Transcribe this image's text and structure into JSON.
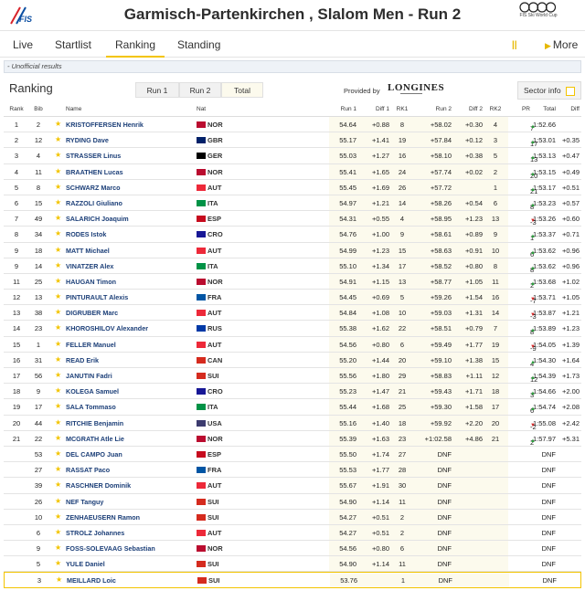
{
  "header": {
    "logo_text": "FIS",
    "title": "Garmisch-Partenkirchen , Slalom Men - Run 2",
    "sponsor_sub": "FIS Ski World Cup"
  },
  "nav": {
    "tabs": [
      "Live",
      "Startlist",
      "Ranking",
      "Standing"
    ],
    "active": "Ranking",
    "pause_icon": "||",
    "more_label": "More"
  },
  "notice": "- Unofficial results",
  "ranking": {
    "heading": "Ranking",
    "buttons": [
      "Run 1",
      "Run 2",
      "Total"
    ],
    "active_button": "Total",
    "provided_by": "Provided by",
    "sponsor": "LONGINES",
    "sector_info": "Sector info"
  },
  "columns": {
    "rank": "Rank",
    "bib": "Bib",
    "name": "Name",
    "nat": "Nat",
    "run1": "Run 1",
    "diff1": "Diff 1",
    "rk1": "RK1",
    "run2": "Run 2",
    "diff2": "Diff 2",
    "rk2": "RK2",
    "pr": "PR",
    "total": "Total",
    "diff": "Diff"
  },
  "flags": {
    "NOR": "#ba0c2f",
    "GBR": "#012169",
    "GER": "#000000",
    "AUT": "#ed2939",
    "ITA": "#009246",
    "ESP": "#c60b1e",
    "CRO": "#171796",
    "FRA": "#0055a4",
    "RUS": "#0039a6",
    "CAN": "#d52b1e",
    "SUI": "#d52b1e",
    "USA": "#3c3b6e"
  },
  "rows": [
    {
      "rank": "1",
      "bib": "2",
      "name": "KRISTOFFERSEN Henrik",
      "nat": "NOR",
      "run1": "54.64",
      "diff1": "+0.88",
      "rk1": "8",
      "run2": "+58.02",
      "diff2": "+0.30",
      "rk2": "4",
      "pr": "7",
      "trend": "up",
      "total": "1:52.66",
      "diff": ""
    },
    {
      "rank": "2",
      "bib": "12",
      "name": "RYDING Dave",
      "nat": "GBR",
      "run1": "55.17",
      "diff1": "+1.41",
      "rk1": "19",
      "run2": "+57.84",
      "diff2": "+0.12",
      "rk2": "3",
      "pr": "17",
      "trend": "up",
      "total": "1:53.01",
      "diff": "+0.35"
    },
    {
      "rank": "3",
      "bib": "4",
      "name": "STRASSER Linus",
      "nat": "GER",
      "run1": "55.03",
      "diff1": "+1.27",
      "rk1": "16",
      "run2": "+58.10",
      "diff2": "+0.38",
      "rk2": "5",
      "pr": "13",
      "trend": "up",
      "total": "1:53.13",
      "diff": "+0.47"
    },
    {
      "rank": "4",
      "bib": "11",
      "name": "BRAATHEN Lucas",
      "nat": "NOR",
      "run1": "55.41",
      "diff1": "+1.65",
      "rk1": "24",
      "run2": "+57.74",
      "diff2": "+0.02",
      "rk2": "2",
      "pr": "20",
      "trend": "up",
      "total": "1:53.15",
      "diff": "+0.49"
    },
    {
      "rank": "5",
      "bib": "8",
      "name": "SCHWARZ Marco",
      "nat": "AUT",
      "run1": "55.45",
      "diff1": "+1.69",
      "rk1": "26",
      "run2": "+57.72",
      "diff2": "",
      "rk2": "1",
      "pr": "21",
      "trend": "up",
      "total": "1:53.17",
      "diff": "+0.51"
    },
    {
      "rank": "6",
      "bib": "15",
      "name": "RAZZOLI Giuliano",
      "nat": "ITA",
      "run1": "54.97",
      "diff1": "+1.21",
      "rk1": "14",
      "run2": "+58.26",
      "diff2": "+0.54",
      "rk2": "6",
      "pr": "8",
      "trend": "up",
      "total": "1:53.23",
      "diff": "+0.57"
    },
    {
      "rank": "7",
      "bib": "49",
      "name": "SALARICH Joaquim",
      "nat": "ESP",
      "run1": "54.31",
      "diff1": "+0.55",
      "rk1": "4",
      "run2": "+58.95",
      "diff2": "+1.23",
      "rk2": "13",
      "pr": "-3",
      "trend": "down",
      "total": "1:53.26",
      "diff": "+0.60"
    },
    {
      "rank": "8",
      "bib": "34",
      "name": "RODES Istok",
      "nat": "CRO",
      "run1": "54.76",
      "diff1": "+1.00",
      "rk1": "9",
      "run2": "+58.61",
      "diff2": "+0.89",
      "rk2": "9",
      "pr": "1",
      "trend": "up",
      "total": "1:53.37",
      "diff": "+0.71"
    },
    {
      "rank": "9",
      "bib": "18",
      "name": "MATT Michael",
      "nat": "AUT",
      "run1": "54.99",
      "diff1": "+1.23",
      "rk1": "15",
      "run2": "+58.63",
      "diff2": "+0.91",
      "rk2": "10",
      "pr": "6",
      "trend": "up",
      "total": "1:53.62",
      "diff": "+0.96"
    },
    {
      "rank": "9",
      "bib": "14",
      "name": "VINATZER Alex",
      "nat": "ITA",
      "run1": "55.10",
      "diff1": "+1.34",
      "rk1": "17",
      "run2": "+58.52",
      "diff2": "+0.80",
      "rk2": "8",
      "pr": "8",
      "trend": "up",
      "total": "1:53.62",
      "diff": "+0.96"
    },
    {
      "rank": "11",
      "bib": "25",
      "name": "HAUGAN Timon",
      "nat": "NOR",
      "run1": "54.91",
      "diff1": "+1.15",
      "rk1": "13",
      "run2": "+58.77",
      "diff2": "+1.05",
      "rk2": "11",
      "pr": "2",
      "trend": "up",
      "total": "1:53.68",
      "diff": "+1.02"
    },
    {
      "rank": "12",
      "bib": "13",
      "name": "PINTURAULT Alexis",
      "nat": "FRA",
      "run1": "54.45",
      "diff1": "+0.69",
      "rk1": "5",
      "run2": "+59.26",
      "diff2": "+1.54",
      "rk2": "16",
      "pr": "-7",
      "trend": "down",
      "total": "1:53.71",
      "diff": "+1.05"
    },
    {
      "rank": "13",
      "bib": "38",
      "name": "DIGRUBER Marc",
      "nat": "AUT",
      "run1": "54.84",
      "diff1": "+1.08",
      "rk1": "10",
      "run2": "+59.03",
      "diff2": "+1.31",
      "rk2": "14",
      "pr": "-3",
      "trend": "down",
      "total": "1:53.87",
      "diff": "+1.21"
    },
    {
      "rank": "14",
      "bib": "23",
      "name": "KHOROSHILOV Alexander",
      "nat": "RUS",
      "run1": "55.38",
      "diff1": "+1.62",
      "rk1": "22",
      "run2": "+58.51",
      "diff2": "+0.79",
      "rk2": "7",
      "pr": "8",
      "trend": "up",
      "total": "1:53.89",
      "diff": "+1.23"
    },
    {
      "rank": "15",
      "bib": "1",
      "name": "FELLER Manuel",
      "nat": "AUT",
      "run1": "54.56",
      "diff1": "+0.80",
      "rk1": "6",
      "run2": "+59.49",
      "diff2": "+1.77",
      "rk2": "19",
      "pr": "-9",
      "trend": "down",
      "total": "1:54.05",
      "diff": "+1.39"
    },
    {
      "rank": "16",
      "bib": "31",
      "name": "READ Erik",
      "nat": "CAN",
      "run1": "55.20",
      "diff1": "+1.44",
      "rk1": "20",
      "run2": "+59.10",
      "diff2": "+1.38",
      "rk2": "15",
      "pr": "4",
      "trend": "up",
      "total": "1:54.30",
      "diff": "+1.64"
    },
    {
      "rank": "17",
      "bib": "56",
      "name": "JANUTIN Fadri",
      "nat": "SUI",
      "run1": "55.56",
      "diff1": "+1.80",
      "rk1": "29",
      "run2": "+58.83",
      "diff2": "+1.11",
      "rk2": "12",
      "pr": "12",
      "trend": "up",
      "total": "1:54.39",
      "diff": "+1.73"
    },
    {
      "rank": "18",
      "bib": "9",
      "name": "KOLEGA Samuel",
      "nat": "CRO",
      "run1": "55.23",
      "diff1": "+1.47",
      "rk1": "21",
      "run2": "+59.43",
      "diff2": "+1.71",
      "rk2": "18",
      "pr": "3",
      "trend": "up",
      "total": "1:54.66",
      "diff": "+2.00"
    },
    {
      "rank": "19",
      "bib": "17",
      "name": "SALA Tommaso",
      "nat": "ITA",
      "run1": "55.44",
      "diff1": "+1.68",
      "rk1": "25",
      "run2": "+59.30",
      "diff2": "+1.58",
      "rk2": "17",
      "pr": "6",
      "trend": "up",
      "total": "1:54.74",
      "diff": "+2.08"
    },
    {
      "rank": "20",
      "bib": "44",
      "name": "RITCHIE Benjamin",
      "nat": "USA",
      "run1": "55.16",
      "diff1": "+1.40",
      "rk1": "18",
      "run2": "+59.92",
      "diff2": "+2.20",
      "rk2": "20",
      "pr": "-2",
      "trend": "down",
      "total": "1:55.08",
      "diff": "+2.42"
    },
    {
      "rank": "21",
      "bib": "22",
      "name": "MCGRATH Atle Lie",
      "nat": "NOR",
      "run1": "55.39",
      "diff1": "+1.63",
      "rk1": "23",
      "run2": "+1:02.58",
      "diff2": "+4.86",
      "rk2": "21",
      "pr": "2",
      "trend": "up",
      "total": "1:57.97",
      "diff": "+5.31"
    },
    {
      "rank": "",
      "bib": "53",
      "name": "DEL CAMPO Juan",
      "nat": "ESP",
      "run1": "55.50",
      "diff1": "+1.74",
      "rk1": "27",
      "run2": "DNF",
      "diff2": "",
      "rk2": "",
      "pr": "",
      "trend": "",
      "total": "DNF",
      "diff": ""
    },
    {
      "rank": "",
      "bib": "27",
      "name": "RASSAT Paco",
      "nat": "FRA",
      "run1": "55.53",
      "diff1": "+1.77",
      "rk1": "28",
      "run2": "DNF",
      "diff2": "",
      "rk2": "",
      "pr": "",
      "trend": "",
      "total": "DNF",
      "diff": ""
    },
    {
      "rank": "",
      "bib": "39",
      "name": "RASCHNER Dominik",
      "nat": "AUT",
      "run1": "55.67",
      "diff1": "+1.91",
      "rk1": "30",
      "run2": "DNF",
      "diff2": "",
      "rk2": "",
      "pr": "",
      "trend": "",
      "total": "DNF",
      "diff": ""
    },
    {
      "rank": "",
      "bib": "26",
      "name": "NEF Tanguy",
      "nat": "SUI",
      "run1": "54.90",
      "diff1": "+1.14",
      "rk1": "11",
      "run2": "DNF",
      "diff2": "",
      "rk2": "",
      "pr": "",
      "trend": "",
      "total": "DNF",
      "diff": ""
    },
    {
      "rank": "",
      "bib": "10",
      "name": "ZENHAEUSERN Ramon",
      "nat": "SUI",
      "run1": "54.27",
      "diff1": "+0.51",
      "rk1": "2",
      "run2": "DNF",
      "diff2": "",
      "rk2": "",
      "pr": "",
      "trend": "",
      "total": "DNF",
      "diff": ""
    },
    {
      "rank": "",
      "bib": "6",
      "name": "STROLZ Johannes",
      "nat": "AUT",
      "run1": "54.27",
      "diff1": "+0.51",
      "rk1": "2",
      "run2": "DNF",
      "diff2": "",
      "rk2": "",
      "pr": "",
      "trend": "",
      "total": "DNF",
      "diff": ""
    },
    {
      "rank": "",
      "bib": "9",
      "name": "FOSS-SOLEVAAG Sebastian",
      "nat": "NOR",
      "run1": "54.56",
      "diff1": "+0.80",
      "rk1": "6",
      "run2": "DNF",
      "diff2": "",
      "rk2": "",
      "pr": "",
      "trend": "",
      "total": "DNF",
      "diff": ""
    },
    {
      "rank": "",
      "bib": "5",
      "name": "YULE Daniel",
      "nat": "SUI",
      "run1": "54.90",
      "diff1": "+1.14",
      "rk1": "11",
      "run2": "DNF",
      "diff2": "",
      "rk2": "",
      "pr": "",
      "trend": "",
      "total": "DNF",
      "diff": ""
    },
    {
      "rank": "",
      "bib": "3",
      "name": "MEILLARD Loic",
      "nat": "SUI",
      "run1": "53.76",
      "diff1": "",
      "rk1": "1",
      "run2": "DNF",
      "diff2": "",
      "rk2": "",
      "pr": "",
      "trend": "",
      "total": "DNF",
      "diff": "",
      "highlight": true
    }
  ]
}
